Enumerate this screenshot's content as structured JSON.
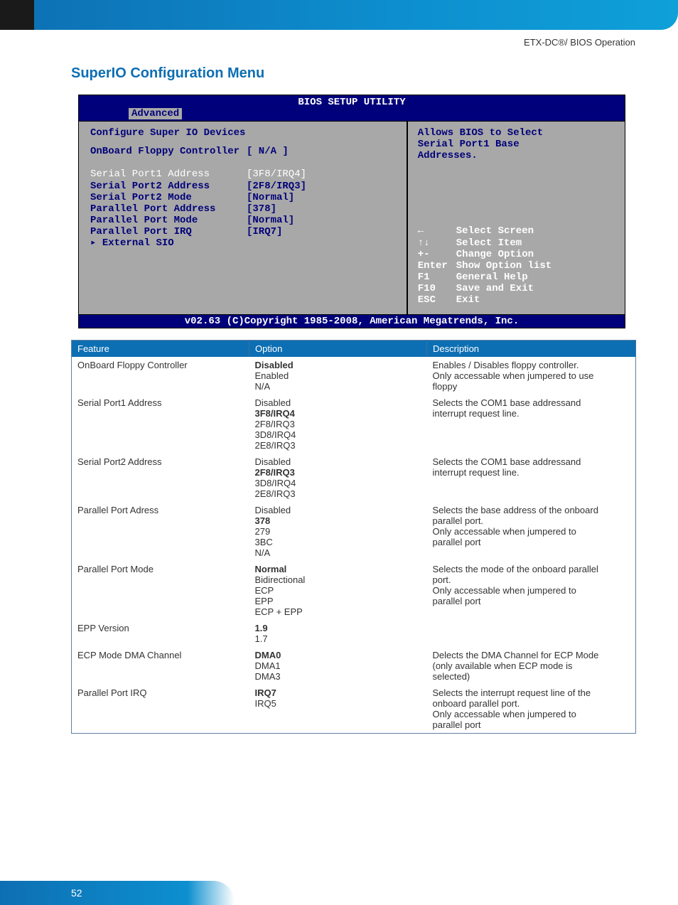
{
  "doc": {
    "header_right": "ETX-DC®/ BIOS Operation",
    "section_title": "SuperIO  Configuration Menu",
    "page_number": "52"
  },
  "bios": {
    "title": "BIOS SETUP UTILITY",
    "active_tab": "Advanced",
    "heading": "Configure Super IO Devices",
    "rows": [
      {
        "label": "OnBoard Floppy Controller",
        "value": "[  N/A  ]",
        "style": "blue"
      },
      {
        "label": "Serial Port1 Address",
        "value": "[3F8/IRQ4]",
        "style": "selected"
      },
      {
        "label": "Serial Port2 Address",
        "value": "[2F8/IRQ3]",
        "style": "blue"
      },
      {
        "label": "  Serial Port2 Mode",
        "value": "[Normal]",
        "style": "blue"
      },
      {
        "label": "Parallel Port Address",
        "value": "[378]",
        "style": "blue"
      },
      {
        "label": "  Parallel Port Mode",
        "value": "[Normal]",
        "style": "blue"
      },
      {
        "label": "  Parallel Port IRQ",
        "value": "[IRQ7]",
        "style": "blue"
      },
      {
        "label": "▸ External SIO",
        "value": "",
        "style": "blue"
      }
    ],
    "help_text_1": "Allows BIOS to Select",
    "help_text_2": "Serial Port1 Base",
    "help_text_3": "Addresses.",
    "nav": [
      {
        "key": "←",
        "desc": "Select Screen"
      },
      {
        "key": "↑↓",
        "desc": "Select Item"
      },
      {
        "key": "+-",
        "desc": "Change Option"
      },
      {
        "key": "Enter",
        "desc": "Show Option list"
      },
      {
        "key": "F1",
        "desc": "General Help"
      },
      {
        "key": "F10",
        "desc": "Save and Exit"
      },
      {
        "key": "ESC",
        "desc": "Exit"
      }
    ],
    "copyright": "v02.63 (C)Copyright 1985-2008, American Megatrends, Inc."
  },
  "table": {
    "headers": {
      "feature": "Feature",
      "option": "Option",
      "description": "Description"
    },
    "groups": [
      {
        "feature": "OnBoard Floppy Controller",
        "options": [
          {
            "text": "Disabled",
            "bold": true
          },
          {
            "text": "Enabled"
          },
          {
            "text": "N/A"
          }
        ],
        "description": [
          "Enables / Disables floppy controller.",
          "Only accessable when jumpered to use",
          "floppy"
        ]
      },
      {
        "feature": "Serial Port1 Address",
        "options": [
          {
            "text": "Disabled"
          },
          {
            "text": "3F8/IRQ4",
            "bold": true
          },
          {
            "text": "2F8/IRQ3"
          },
          {
            "text": "3D8/IRQ4"
          },
          {
            "text": "2E8/IRQ3"
          }
        ],
        "description": [
          "Selects the COM1 base addressand",
          "interrupt request line.",
          "",
          "",
          ""
        ]
      },
      {
        "feature": "Serial Port2 Address",
        "options": [
          {
            "text": "Disabled"
          },
          {
            "text": "2F8/IRQ3",
            "bold": true
          },
          {
            "text": "3D8/IRQ4"
          },
          {
            "text": "2E8/IRQ3"
          }
        ],
        "description": [
          "Selects the COM1 base addressand",
          "interrupt request line.",
          "",
          ""
        ]
      },
      {
        "feature": "Parallel Port Adress",
        "options": [
          {
            "text": "Disabled"
          },
          {
            "text": "378",
            "bold": true
          },
          {
            "text": "279"
          },
          {
            "text": "3BC"
          },
          {
            "text": "N/A"
          }
        ],
        "description": [
          "Selects the base address of the onboard",
          "parallel port.",
          "Only accessable when jumpered to",
          "parallel port",
          ""
        ]
      },
      {
        "feature": "Parallel Port Mode",
        "options": [
          {
            "text": "Normal",
            "bold": true
          },
          {
            "text": "Bidirectional"
          },
          {
            "text": "ECP"
          },
          {
            "text": "EPP"
          },
          {
            "text": "ECP + EPP"
          }
        ],
        "description": [
          "Selects the mode of the onboard parallel",
          "port.",
          "Only accessable when jumpered to",
          "parallel port",
          ""
        ]
      },
      {
        "feature": "EPP Version",
        "options": [
          {
            "text": "1.9",
            "bold": true
          },
          {
            "text": "1.7"
          }
        ],
        "description": [
          "",
          ""
        ]
      },
      {
        "feature": "ECP Mode DMA Channel",
        "options": [
          {
            "text": "DMA0",
            "bold": true
          },
          {
            "text": "DMA1"
          },
          {
            "text": "DMA3"
          }
        ],
        "description": [
          "Delects the DMA Channel for ECP Mode",
          "(only available when ECP mode is",
          "selected)"
        ]
      },
      {
        "feature": "Parallel Port IRQ",
        "options": [
          {
            "text": "IRQ7",
            "bold": true
          },
          {
            "text": "IRQ5"
          },
          {
            "text": ""
          },
          {
            "text": ""
          }
        ],
        "description": [
          "Selects the interrupt request line of the",
          "onboard parallel port.",
          "Only accessable when jumpered to",
          "parallel port"
        ]
      }
    ]
  }
}
